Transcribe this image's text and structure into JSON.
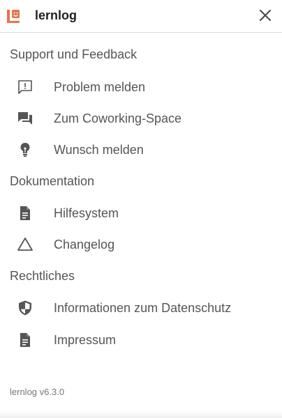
{
  "header": {
    "app_name": "lernlog",
    "logo_icon": "lernlog-logo-icon",
    "close_icon": "close-icon",
    "brand_color": "#e8734a"
  },
  "sections": [
    {
      "title": "Support und Feedback",
      "items": [
        {
          "label": "Problem melden",
          "icon": "report-problem-icon"
        },
        {
          "label": "Zum Coworking-Space",
          "icon": "forum-icon"
        },
        {
          "label": "Wunsch melden",
          "icon": "lightbulb-icon"
        }
      ]
    },
    {
      "title": "Dokumentation",
      "items": [
        {
          "label": "Hilfesystem",
          "icon": "document-icon"
        },
        {
          "label": "Changelog",
          "icon": "triangle-icon"
        }
      ]
    },
    {
      "title": "Rechtliches",
      "items": [
        {
          "label": "Informationen zum Datenschutz",
          "icon": "shield-icon"
        },
        {
          "label": "Impressum",
          "icon": "document-icon"
        }
      ]
    }
  ],
  "footer": {
    "version": "lernlog v6.3.0"
  }
}
